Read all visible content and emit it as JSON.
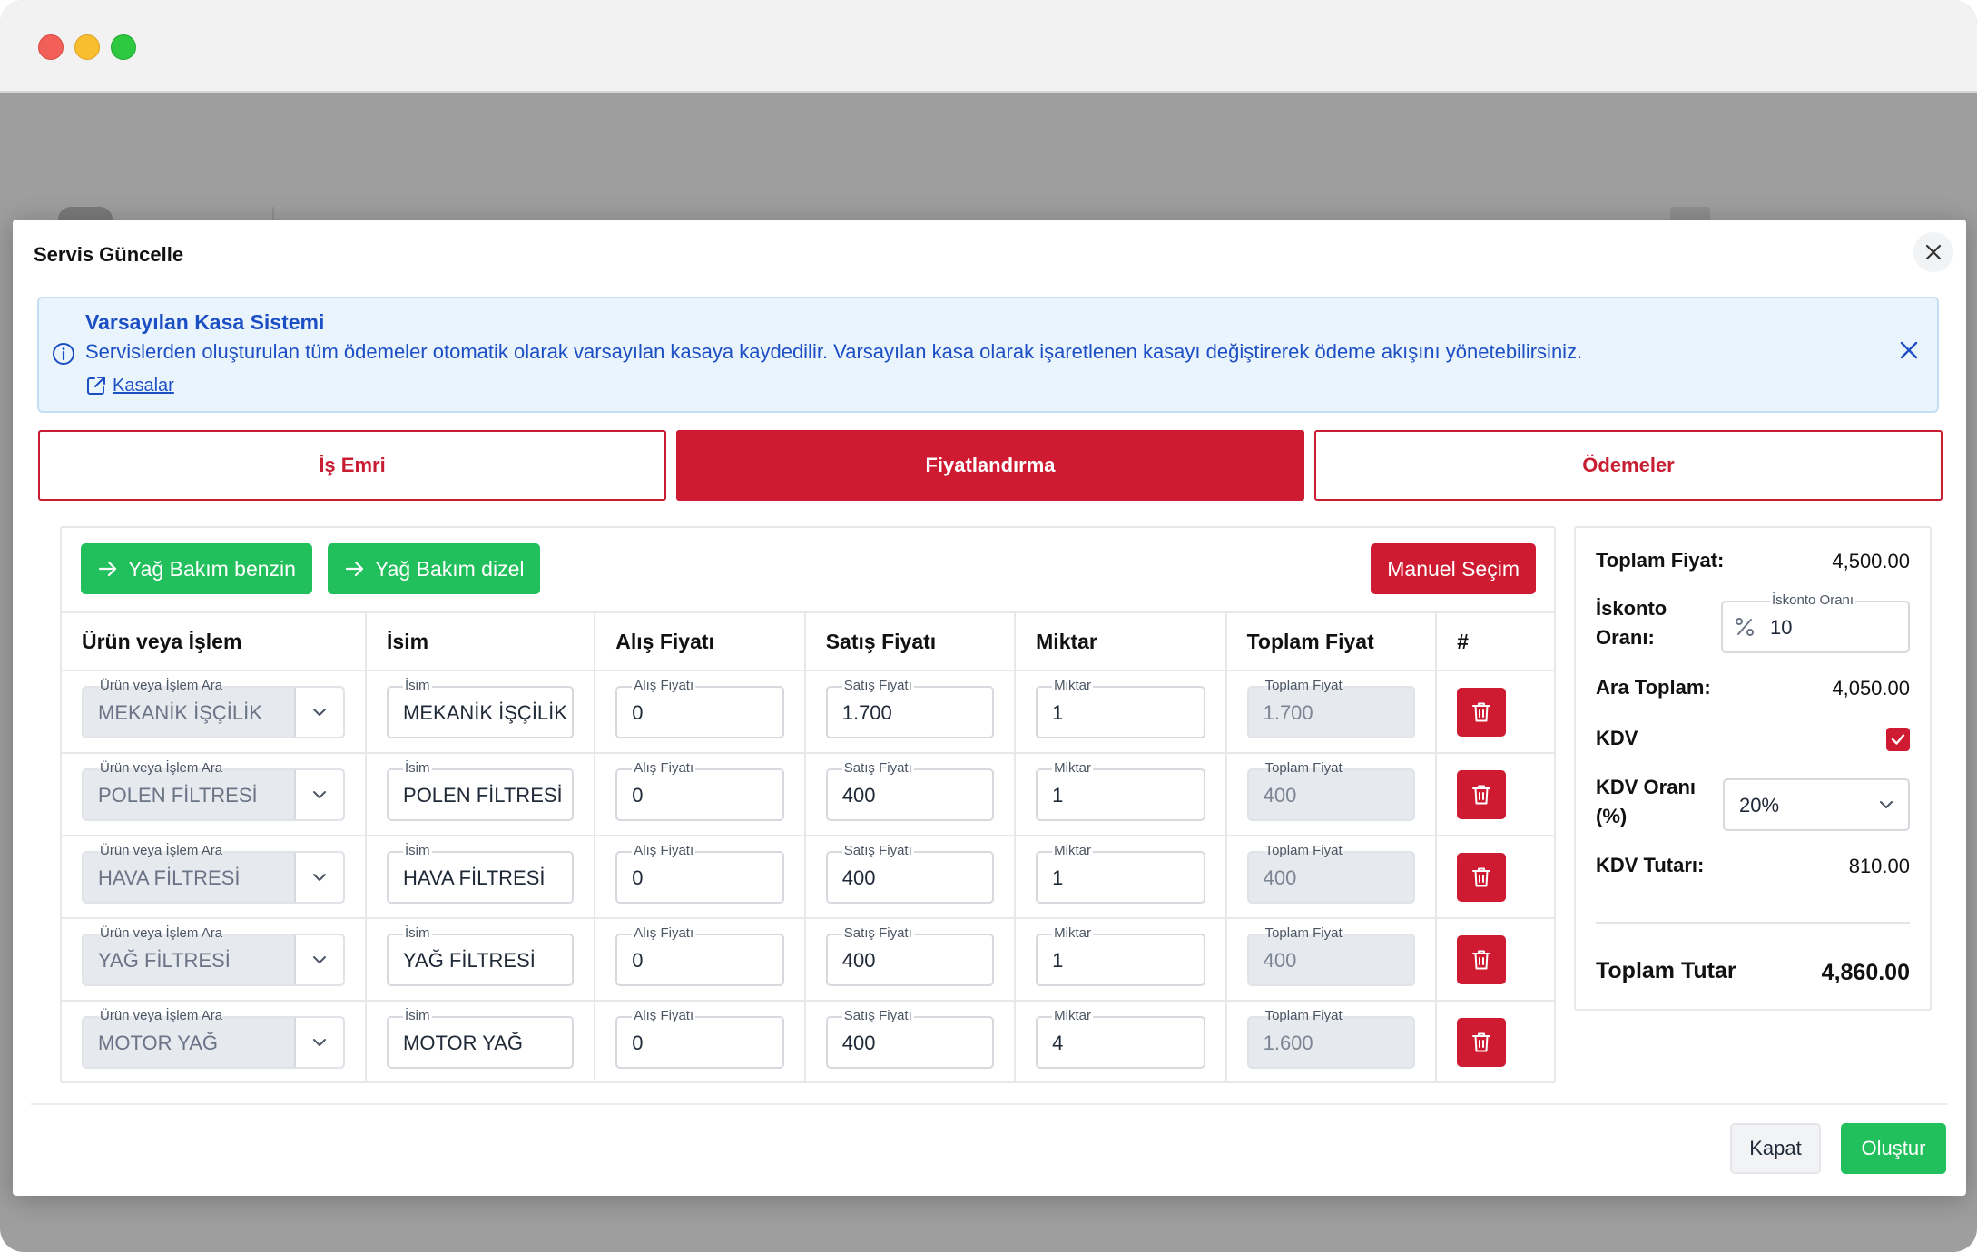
{
  "modal": {
    "title": "Servis Güncelle",
    "close_label": "×"
  },
  "alert": {
    "title": "Varsayılan Kasa Sistemi",
    "text": "Servislerden oluşturulan tüm ödemeler otomatik olarak varsayılan kasaya kaydedilir. Varsayılan kasa olarak işaretlenen kasayı değiştirerek ödeme akışını yönetebilirsiniz.",
    "link": "Kasalar"
  },
  "tabs": [
    {
      "label": "İş Emri"
    },
    {
      "label": "Fiyatlandırma"
    },
    {
      "label": "Ödemeler"
    }
  ],
  "actions": {
    "preset1": "Yağ Bakım benzin",
    "preset2": "Yağ Bakım dizel",
    "manual": "Manuel Seçim"
  },
  "table": {
    "headers": [
      "Ürün veya İşlem",
      "İsim",
      "Alış Fiyatı",
      "Satış Fiyatı",
      "Miktar",
      "Toplam Fiyat",
      "#"
    ],
    "field_labels": {
      "product": "Ürün veya İşlem Ara",
      "name": "İsim",
      "buy": "Alış Fiyatı",
      "sell": "Satış Fiyatı",
      "qty": "Miktar",
      "total": "Toplam Fiyat"
    },
    "rows": [
      {
        "product": "MEKANİK İŞÇİLİK",
        "name": "MEKANİK İŞÇİLİK",
        "buy": "0",
        "sell": "1.700",
        "qty": "1",
        "total": "1.700"
      },
      {
        "product": "POLEN FİLTRESİ",
        "name": "POLEN FİLTRESİ",
        "buy": "0",
        "sell": "400",
        "qty": "1",
        "total": "400"
      },
      {
        "product": "HAVA FİLTRESİ",
        "name": "HAVA FİLTRESİ",
        "buy": "0",
        "sell": "400",
        "qty": "1",
        "total": "400"
      },
      {
        "product": "YAĞ FİLTRESİ",
        "name": "YAĞ FİLTRESİ",
        "buy": "0",
        "sell": "400",
        "qty": "1",
        "total": "400"
      },
      {
        "product": "MOTOR YAĞ",
        "name": "MOTOR YAĞ",
        "buy": "0",
        "sell": "400",
        "qty": "4",
        "total": "1.600"
      }
    ]
  },
  "summary": {
    "total_price_label": "Toplam Fiyat:",
    "total_price": "4,500.00",
    "discount_label_1": "İskonto",
    "discount_label_2": "Oranı:",
    "discount_field_label": "İskonto Oranı",
    "discount_value": "10",
    "subtotal_label": "Ara Toplam:",
    "subtotal": "4,050.00",
    "kdv_label": "KDV",
    "kdv_checked": true,
    "kdv_rate_label_1": "KDV Oranı",
    "kdv_rate_label_2": "(%)",
    "kdv_rate": "20%",
    "kdv_amount_label": "KDV Tutarı:",
    "kdv_amount": "810.00",
    "grand_total_label": "Toplam Tutar",
    "grand_total": "4,860.00"
  },
  "footer": {
    "close": "Kapat",
    "create": "Oluştur"
  },
  "colors": {
    "primary_red": "#cf1b31",
    "success_green": "#22c05c",
    "info_blue": "#1d4fc4"
  }
}
